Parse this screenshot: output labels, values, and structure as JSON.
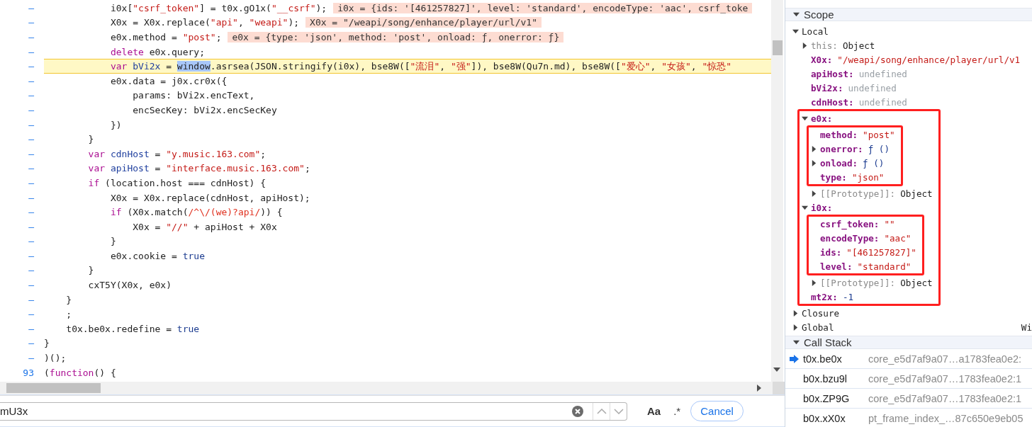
{
  "editor": {
    "lines": [
      {
        "gutter": "–",
        "paused": false,
        "code": [
          {
            "kind": "plain",
            "text": "            i0x["
          },
          {
            "kind": "string",
            "text": "\"csrf_token\""
          },
          {
            "kind": "plain",
            "text": "] = t0x.gO1x("
          },
          {
            "kind": "string",
            "text": "\"__csrf\""
          },
          {
            "kind": "plain",
            "text": ");"
          }
        ],
        "inline_value": "i0x = {ids: '[461257827]', level: 'standard', encodeType: 'aac', csrf_toke"
      },
      {
        "gutter": "–",
        "paused": false,
        "code": [
          {
            "kind": "plain",
            "text": "            X0x = X0x.replace("
          },
          {
            "kind": "string",
            "text": "\"api\""
          },
          {
            "kind": "plain",
            "text": ", "
          },
          {
            "kind": "string",
            "text": "\"weapi\""
          },
          {
            "kind": "plain",
            "text": ");"
          }
        ],
        "inline_value": "X0x = \"/weapi/song/enhance/player/url/v1\""
      },
      {
        "gutter": "–",
        "paused": false,
        "code": [
          {
            "kind": "plain",
            "text": "            e0x.method = "
          },
          {
            "kind": "string",
            "text": "\"post\""
          },
          {
            "kind": "plain",
            "text": ";"
          }
        ],
        "inline_value": "e0x = {type: 'json', method: 'post', onload: ƒ, onerror: ƒ}"
      },
      {
        "gutter": "–",
        "paused": false,
        "code": [
          {
            "kind": "keyword",
            "text": "            delete"
          },
          {
            "kind": "plain",
            "text": " e0x.query;"
          }
        ]
      },
      {
        "gutter": "–",
        "paused": true,
        "code": [
          {
            "kind": "keyword",
            "text": "            var"
          },
          {
            "kind": "def",
            "text": " bVi2x"
          },
          {
            "kind": "plain",
            "text": " = "
          },
          {
            "kind": "selection",
            "text": "window"
          },
          {
            "kind": "plain",
            "text": ".asrsea(JSON.stringify(i0x), bse8W(["
          },
          {
            "kind": "string",
            "text": "\"流泪\""
          },
          {
            "kind": "plain",
            "text": ", "
          },
          {
            "kind": "string",
            "text": "\"强\""
          },
          {
            "kind": "plain",
            "text": "]), bse8W(Qu7n.md), bse8W(["
          },
          {
            "kind": "string",
            "text": "\"爱心\""
          },
          {
            "kind": "plain",
            "text": ", "
          },
          {
            "kind": "string",
            "text": "\"女孩\""
          },
          {
            "kind": "plain",
            "text": ", "
          },
          {
            "kind": "string",
            "text": "\"惊恐\""
          }
        ]
      },
      {
        "gutter": "–",
        "paused": false,
        "code": [
          {
            "kind": "plain",
            "text": "            e0x.data = j0x.cr0x({"
          }
        ]
      },
      {
        "gutter": "–",
        "paused": false,
        "code": [
          {
            "kind": "plain",
            "text": "                params: bVi2x.encText,"
          }
        ]
      },
      {
        "gutter": "–",
        "paused": false,
        "code": [
          {
            "kind": "plain",
            "text": "                encSecKey: bVi2x.encSecKey"
          }
        ]
      },
      {
        "gutter": "–",
        "paused": false,
        "code": [
          {
            "kind": "plain",
            "text": "            })"
          }
        ]
      },
      {
        "gutter": "–",
        "paused": false,
        "code": [
          {
            "kind": "plain",
            "text": "        }"
          }
        ]
      },
      {
        "gutter": "–",
        "paused": false,
        "code": [
          {
            "kind": "keyword",
            "text": "        var"
          },
          {
            "kind": "def",
            "text": " cdnHost"
          },
          {
            "kind": "plain",
            "text": " = "
          },
          {
            "kind": "string",
            "text": "\"y.music.163.com\""
          },
          {
            "kind": "plain",
            "text": ";"
          }
        ]
      },
      {
        "gutter": "–",
        "paused": false,
        "code": [
          {
            "kind": "keyword",
            "text": "        var"
          },
          {
            "kind": "def",
            "text": " apiHost"
          },
          {
            "kind": "plain",
            "text": " = "
          },
          {
            "kind": "string",
            "text": "\"interface.music.163.com\""
          },
          {
            "kind": "plain",
            "text": ";"
          }
        ]
      },
      {
        "gutter": "–",
        "paused": false,
        "code": [
          {
            "kind": "keyword",
            "text": "        if"
          },
          {
            "kind": "plain",
            "text": " (location.host === cdnHost) {"
          }
        ]
      },
      {
        "gutter": "–",
        "paused": false,
        "code": [
          {
            "kind": "plain",
            "text": "            X0x = X0x.replace(cdnHost, apiHost);"
          }
        ]
      },
      {
        "gutter": "–",
        "paused": false,
        "code": [
          {
            "kind": "keyword",
            "text": "            if"
          },
          {
            "kind": "plain",
            "text": " (X0x.match("
          },
          {
            "kind": "regex",
            "text": "/^\\/(we)?api/"
          },
          {
            "kind": "plain",
            "text": ")) {"
          }
        ]
      },
      {
        "gutter": "–",
        "paused": false,
        "code": [
          {
            "kind": "plain",
            "text": "                X0x = "
          },
          {
            "kind": "string",
            "text": "\"//\""
          },
          {
            "kind": "plain",
            "text": " + apiHost + X0x"
          }
        ]
      },
      {
        "gutter": "–",
        "paused": false,
        "code": [
          {
            "kind": "plain",
            "text": "            }"
          }
        ]
      },
      {
        "gutter": "–",
        "paused": false,
        "code": [
          {
            "kind": "plain",
            "text": "            e0x.cookie = "
          },
          {
            "kind": "atom",
            "text": "true"
          }
        ]
      },
      {
        "gutter": "–",
        "paused": false,
        "code": [
          {
            "kind": "plain",
            "text": "        }"
          }
        ]
      },
      {
        "gutter": "–",
        "paused": false,
        "code": [
          {
            "kind": "plain",
            "text": "        cxT5Y(X0x, e0x)"
          }
        ]
      },
      {
        "gutter": "–",
        "paused": false,
        "code": [
          {
            "kind": "plain",
            "text": "    }"
          }
        ]
      },
      {
        "gutter": "–",
        "paused": false,
        "code": [
          {
            "kind": "plain",
            "text": "    ;"
          }
        ]
      },
      {
        "gutter": "–",
        "paused": false,
        "code": [
          {
            "kind": "plain",
            "text": "    t0x.be0x.redefine = "
          },
          {
            "kind": "atom",
            "text": "true"
          }
        ]
      },
      {
        "gutter": "–",
        "paused": false,
        "code": [
          {
            "kind": "plain",
            "text": "}"
          }
        ]
      },
      {
        "gutter": "–",
        "paused": false,
        "code": [
          {
            "kind": "plain",
            "text": ")();"
          }
        ]
      },
      {
        "gutter": "93",
        "paused": false,
        "code": [
          {
            "kind": "plain",
            "text": "("
          },
          {
            "kind": "keyword",
            "text": "function"
          },
          {
            "kind": "plain",
            "text": "() {"
          }
        ]
      }
    ]
  },
  "search": {
    "value": "mU3x",
    "match_case": "Aa",
    "regex": ".*",
    "cancel": "Cancel"
  },
  "scope": {
    "title": "Scope",
    "expanded": true,
    "sections": [
      {
        "name": "Local",
        "expanded": true,
        "children": [
          {
            "kind": "prop",
            "name": "this:",
            "dim": true,
            "expanded": false,
            "value": "Object",
            "color": "#222222"
          },
          {
            "kind": "prop",
            "name": "X0x:",
            "value": "\"/weapi/song/enhance/player/url/v1",
            "color": "#c41a16"
          },
          {
            "kind": "prop",
            "name": "apiHost:",
            "value": "undefined",
            "color": "#9aa0a6"
          },
          {
            "kind": "prop",
            "name": "bVi2x:",
            "value": "undefined",
            "color": "#9aa0a6"
          },
          {
            "kind": "prop",
            "name": "cdnHost:",
            "value": "undefined",
            "color": "#9aa0a6"
          },
          {
            "kind": "frame",
            "children": [
              {
                "kind": "prop",
                "name": "e0x:",
                "expanded": true,
                "children": [
                  {
                    "kind": "frame",
                    "children": [
                      {
                        "kind": "prop",
                        "name": "method:",
                        "value": "\"post\"",
                        "color": "#c41a16"
                      },
                      {
                        "kind": "prop",
                        "name": "onerror:",
                        "expanded": false,
                        "value": "ƒ ()",
                        "color": "#1a3a8f"
                      },
                      {
                        "kind": "prop",
                        "name": "onload:",
                        "expanded": false,
                        "value": "ƒ ()",
                        "color": "#1a3a8f"
                      },
                      {
                        "kind": "prop",
                        "name": "type:",
                        "value": "\"json\"",
                        "color": "#c41a16"
                      }
                    ]
                  },
                  {
                    "kind": "prop",
                    "name": "[[Prototype]]:",
                    "dim": true,
                    "expanded": false,
                    "value": "Object",
                    "color": "#222222"
                  }
                ]
              },
              {
                "kind": "prop",
                "name": "i0x:",
                "expanded": true,
                "children": [
                  {
                    "kind": "frame",
                    "children": [
                      {
                        "kind": "prop",
                        "name": "csrf_token:",
                        "value": "\"\"",
                        "color": "#c41a16"
                      },
                      {
                        "kind": "prop",
                        "name": "encodeType:",
                        "value": "\"aac\"",
                        "color": "#c41a16"
                      },
                      {
                        "kind": "prop",
                        "name": "ids:",
                        "value": "\"[461257827]\"",
                        "color": "#c41a16"
                      },
                      {
                        "kind": "prop",
                        "name": "level:",
                        "value": "\"standard\"",
                        "color": "#c41a16"
                      }
                    ]
                  },
                  {
                    "kind": "prop",
                    "name": "[[Prototype]]:",
                    "dim": true,
                    "expanded": false,
                    "value": "Object",
                    "color": "#222222"
                  }
                ]
              },
              {
                "kind": "prop",
                "name": "mt2x:",
                "value": "-1",
                "color": "#1a3a8f"
              }
            ]
          }
        ]
      },
      {
        "name": "Closure",
        "expanded": false
      },
      {
        "name": "Global",
        "expanded": false,
        "value": "Wi"
      }
    ]
  },
  "call_stack": {
    "title": "Call Stack",
    "expanded": true,
    "frames": [
      {
        "function": "t0x.be0x",
        "location": "core_e5d7af9a07…a1783fea0e2:",
        "current": true
      },
      {
        "function": "b0x.bzu9l",
        "location": "core_e5d7af9a07…1783fea0e2:1",
        "current": false
      },
      {
        "function": "b0x.ZP9G",
        "location": "core_e5d7af9a07…1783fea0e2:1",
        "current": false
      },
      {
        "function": "b0x.xX0x",
        "location": "pt_frame_index_…87c650e9eb05",
        "current": false
      }
    ]
  }
}
